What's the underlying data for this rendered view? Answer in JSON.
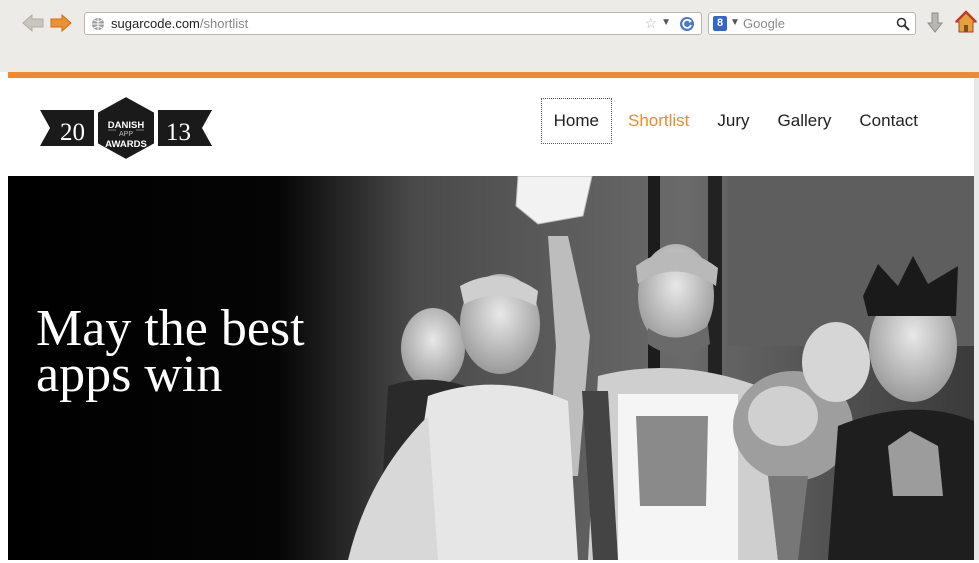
{
  "browser": {
    "url_domain": "sugarcode.com",
    "url_path": "/shortlist",
    "search_placeholder": "Google",
    "search_engine_letter": "8",
    "icons": [
      "back-arrow-icon",
      "forward-arrow-icon",
      "globe-icon",
      "bookmark-star-icon",
      "dropdown-icon",
      "reload-icon",
      "google-icon",
      "magnifier-icon",
      "download-icon",
      "home-icon"
    ]
  },
  "site": {
    "logo": {
      "year_left": "20",
      "year_right": "13",
      "line1": "DANISH",
      "line2": "APP",
      "line3": "AWARDS"
    },
    "nav": [
      {
        "label": "Home"
      },
      {
        "label": "Shortlist"
      },
      {
        "label": "Jury"
      },
      {
        "label": "Gallery"
      },
      {
        "label": "Contact"
      }
    ],
    "hero_title": "May the best apps win",
    "accent_color": "#ef8b2c"
  }
}
